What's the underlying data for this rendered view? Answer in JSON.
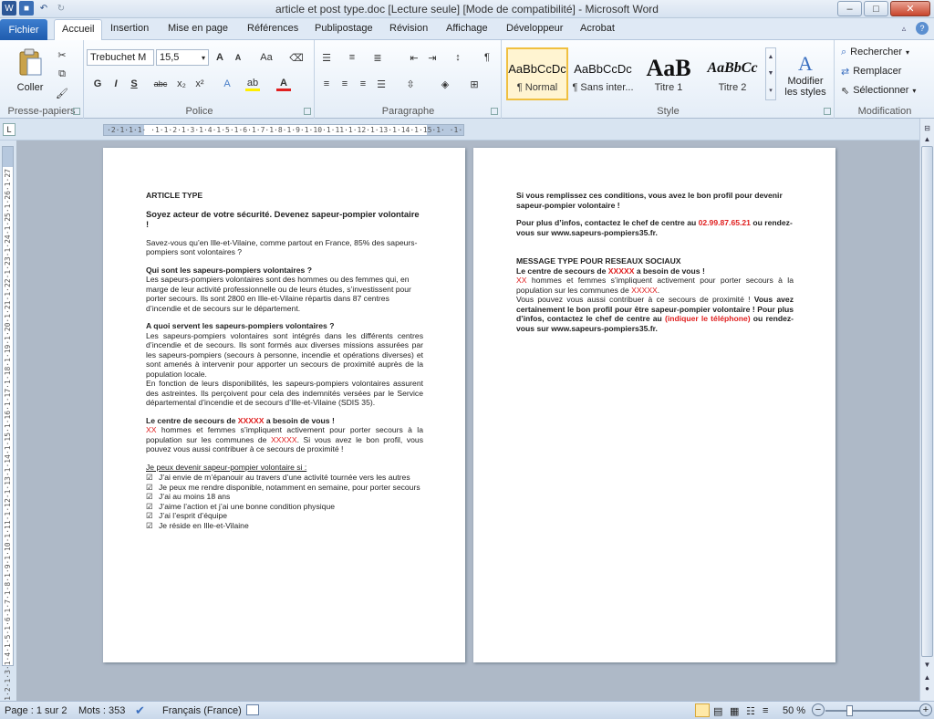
{
  "window": {
    "title": "article et post type.doc [Lecture seule] [Mode de compatibilité] - Microsoft Word",
    "minimize": "–",
    "maximize": "□",
    "close": "✕"
  },
  "quick_access": {
    "app_icon": "W",
    "save": "■",
    "undo": "↶",
    "redo": "↻"
  },
  "tabs": {
    "fichier": "Fichier",
    "items": [
      "Accueil",
      "Insertion",
      "Mise en page",
      "Références",
      "Publipostage",
      "Révision",
      "Affichage",
      "Développeur",
      "Acrobat"
    ],
    "help": "?"
  },
  "ribbon": {
    "clipboard": {
      "label": "Presse-papiers",
      "paste": "Coller"
    },
    "font": {
      "label": "Police",
      "font_name": "Trebuchet M",
      "font_size": "15,5",
      "bold": "G",
      "italic": "I",
      "underline": "S",
      "strike": "abc",
      "sub": "x₂",
      "sup": "x²",
      "grow": "A",
      "shrink": "A",
      "case": "Aa",
      "color": "A"
    },
    "paragraph": {
      "label": "Paragraphe",
      "pilcrow": "¶"
    },
    "styles": {
      "label": "Style",
      "items": [
        {
          "sample": "AaBbCcDc",
          "name": "¶ Normal"
        },
        {
          "sample": "AaBbCcDc",
          "name": "¶ Sans inter..."
        },
        {
          "sample": "AaB",
          "name": "Titre 1"
        },
        {
          "sample": "AaBbCc",
          "name": "Titre 2"
        }
      ],
      "modify_line1": "Modifier",
      "modify_line2": "les styles"
    },
    "editing": {
      "label": "Modification",
      "find": "Rechercher",
      "replace": "Remplacer",
      "select": "Sélectionner"
    }
  },
  "ruler": {
    "horizontal": "·2·1·1·1· ·1·1·2·1·3·1·4·1·5·1·6·1·7·1·8·1·9·1·10·1·11·1·12·1·13·1·14·1·15·1· ·1·17·18",
    "vertical": "2·1·1·1·2·1·3·1·4·1·5·1·6·1·7·1·8·1·9·1·10·1·11·1·12·1·13·1·14·1·15·1·16·1·17·1·18·1·19·1·20·1·21·1·22·1·23·1·24·1·25·1·26·1·27",
    "tab_selector": "L"
  },
  "page1": {
    "title": "ARTICLE TYPE",
    "headline": "Soyez acteur de votre sécurité. Devenez sapeur-pompier volontaire !",
    "intro": "Savez-vous qu’en Ille-et-Vilaine, comme partout en France, 85% des sapeurs-pompiers sont volontaires ?",
    "q1": "Qui sont les sapeurs-pompiers volontaires ?",
    "q1_body": "Les sapeurs-pompiers volontaires sont des hommes ou des femmes qui, en marge de leur activité professionnelle ou de leurs études, s’investissent pour porter secours. Ils sont 2800 en Ille-et-Vilaine répartis dans 87 centres d’incendie et de secours sur le département.",
    "q2": "A quoi servent les sapeurs-pompiers volontaires ?",
    "q2_body1": "Les sapeurs-pompiers volontaires sont intégrés dans les différents centres d’incendie et de secours. Ils sont formés aux diverses missions assurées par les sapeurs-pompiers (secours à personne, incendie et opérations diverses) et sont amenés à intervenir pour apporter un secours de proximité auprès de la population locale.",
    "q2_body2": "En fonction de leurs disponibilités, les sapeurs-pompiers volontaires assurent des astreintes. Ils perçoivent pour cela des indemnités versées par le Service départemental d’incendie et de secours d’Ille-et-Vilaine (SDIS 35).",
    "centre_pre": "Le centre de secours de ",
    "centre_red": "XXXXX",
    "centre_post": " a besoin de vous !",
    "centre_xx": "XX",
    "centre_body_a": " hommes et femmes s’impliquent activement pour porter secours à la population sur les communes de ",
    "centre_xxxxx": "XXXXX",
    "centre_body_b": ". Si vous avez le bon profil, vous pouvez vous aussi contribuer à ce secours de proximité !",
    "checklist_title": "Je peux devenir sapeur-pompier volontaire si :",
    "check_mark": "☑",
    "checklist": [
      "J’ai envie de m’épanouir au travers d’une activité tournée vers les autres",
      "Je peux me rendre disponible, notamment en semaine, pour porter secours",
      "J’ai au moins 18 ans",
      "J’aime l’action et j’ai une bonne condition physique",
      "J’ai l’esprit d’équipe",
      "Je réside en Ille-et-Vilaine"
    ]
  },
  "page2": {
    "profile": "Si vous remplissez ces conditions, vous avez le bon profil pour devenir sapeur-pompier volontaire !",
    "contact_a": "Pour plus d’infos, contactez le chef de centre au ",
    "contact_phone": "02.99.87.65.21",
    "contact_b": " ou rendez-vous sur www.sapeurs-pompiers35.fr.",
    "social_title": "MESSAGE TYPE POUR RESEAUX SOCIAUX",
    "social_h_pre": "Le centre de secours de ",
    "social_h_red": "XXXXX",
    "social_h_post": " a besoin de vous !",
    "social_xx": "XX",
    "social_body_a": " hommes et femmes s’impliquent activement pour porter secours à la population sur les communes de ",
    "social_xxxxx": "XXXXX",
    "social_body_b": ".",
    "social_body_c": "Vous pouvez vous aussi contribuer à ce secours de proximité ! ",
    "social_bold_a": "Vous avez certainement le bon profil pour être sapeur-pompier volontaire ! Pour plus d’infos, contactez le chef de centre au ",
    "social_phone": "(indiquer le téléphone)",
    "social_bold_b": " ou rendez-vous sur www.sapeurs-pompiers35.fr."
  },
  "status": {
    "page": "Page : 1 sur 2",
    "words": "Mots : 353",
    "language": "Français (France)",
    "zoom": "50 %",
    "zoom_minus": "−",
    "zoom_plus": "+"
  },
  "colors": {
    "accent": "#1f5cae",
    "red_text": "#e02020"
  }
}
